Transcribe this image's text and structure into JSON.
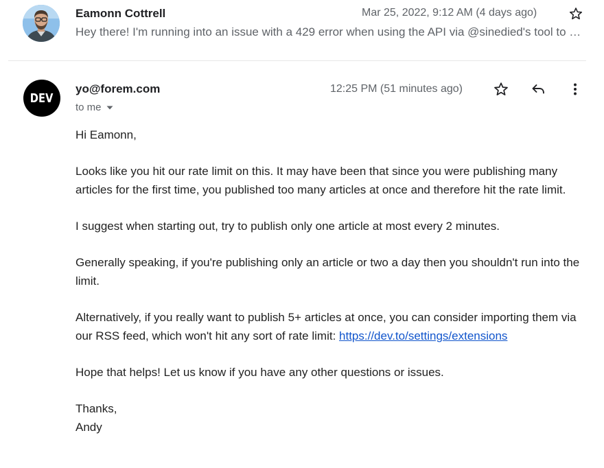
{
  "thread": {
    "messages": [
      {
        "sender": "Eamonn Cottrell",
        "date": "Mar 25, 2022, 9:12 AM (4 days ago)",
        "snippet": "Hey there! I'm running into an issue with a 429 error when using the API via @sinedied's tool to publish a bunch of articles at once.",
        "avatar_icon": "user-photo-avatar",
        "starred": false
      },
      {
        "sender": "yo@forem.com",
        "date": "12:25 PM (51 minutes ago)",
        "recipient": "to me",
        "avatar_text": "DEV",
        "starred": false,
        "body": {
          "greeting": "Hi Eamonn,",
          "p1": "Looks like you hit our rate limit on this. It may have been that since you were publishing many articles for the first time, you published too many articles at once and therefore hit the rate limit.",
          "p2": "I suggest when starting out, try to publish only one article at most every 2 minutes.",
          "p3": "Generally speaking, if you're publishing only an article or two a day then you shouldn't run into the limit.",
          "p4_text": "Alternatively, if you really want to publish 5+ articles at once, you can consider importing them via our RSS feed, which won't hit any sort of rate limit: ",
          "p4_link": "https://dev.to/settings/extensions",
          "p5": "Hope that helps! Let us know if you have any other questions or issues.",
          "sign_thanks": "Thanks,",
          "sign_name": "Andy"
        }
      }
    ]
  },
  "icons": {
    "star": "star-outline-icon",
    "reply": "reply-arrow-icon",
    "more": "more-vertical-icon",
    "dropdown": "caret-down-icon"
  },
  "colors": {
    "link": "#1155cc",
    "secondary_text": "#5f6368",
    "primary_text": "#202124",
    "dev_badge": "#000000",
    "photo_bg": "#7fb2e0"
  }
}
